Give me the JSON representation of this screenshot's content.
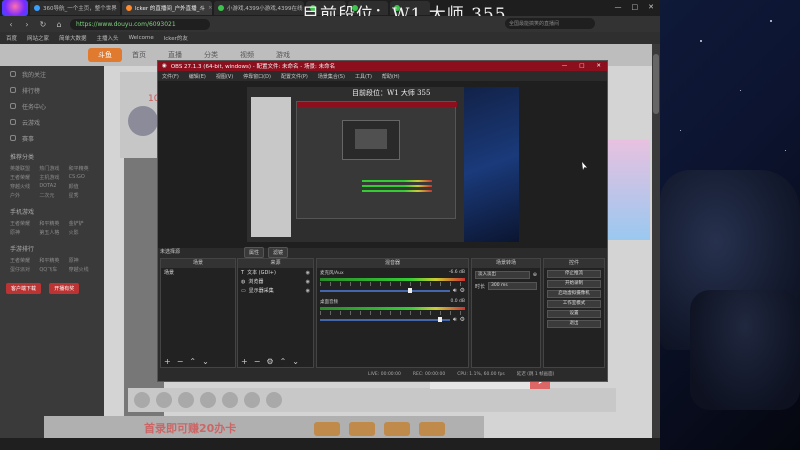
{
  "overlay_title": "目前段位：W1 大师 355",
  "browser": {
    "tabs": [
      {
        "label": "360导航_一个主页，整个世界",
        "color": "#3aa0ff"
      },
      {
        "label": "lcker 的直播间_户外直播_斗",
        "color": "#ff8a2b",
        "active": true
      },
      {
        "label": "小游戏,4399小游戏,4399在线",
        "color": "#3ec24e"
      },
      {
        "label": "",
        "color": "#3ec24e"
      },
      {
        "label": "",
        "color": "#3ec24e"
      },
      {
        "label": "",
        "color": "#3ec24e"
      }
    ],
    "url": "https://www.douyu.com/6093021",
    "bookmarks": [
      "百度",
      "网站之家",
      "简单大数据",
      "主播入头",
      "Welcome",
      "lcker的友"
    ],
    "search_placeholder": "全国最能搞笑的直播间"
  },
  "site": {
    "logo": "斗鱼",
    "nav": [
      "首页",
      "直播",
      "分类",
      "视频",
      "游戏"
    ],
    "sidebar": {
      "items": [
        "我的关注",
        "排行榜",
        "任务中心",
        "云游戏",
        "赛事"
      ],
      "sections": [
        {
          "title": "推荐分类",
          "tags": [
            "英雄联盟",
            "热门游戏",
            "和平精英",
            "王者荣耀",
            "主机游戏",
            "CS:GO",
            "穿越火线",
            "DOTA2",
            "颜值",
            "户外",
            "二次元",
            "星秀"
          ]
        },
        {
          "title": "手机游戏",
          "tags": [
            "王者荣耀",
            "和平精英",
            "金铲铲",
            "原神",
            "第五人格",
            "火影"
          ]
        },
        {
          "title": "手游排行",
          "tags": [
            "王者荣耀",
            "和平精英",
            "原神",
            "蛋仔派对",
            "QQ飞车",
            "穿越火线"
          ]
        }
      ],
      "buttons": [
        "客户端下载",
        "开播有奖"
      ]
    },
    "room_count": "10",
    "banner_text": "首录即可赚20办卡"
  },
  "obs": {
    "title": "OBS 27.1.3 (64-bit, windows) - 配置文件: 未命名 - 场景: 未命名",
    "menu": [
      "文件(F)",
      "编辑(E)",
      "视图(V)",
      "停靠窗口(D)",
      "配置文件(P)",
      "场景集合(S)",
      "工具(T)",
      "帮助(H)"
    ],
    "scene_label": "未选择源",
    "toolbar": [
      "属性",
      "滤镜"
    ],
    "docks": {
      "scenes": {
        "title": "场景",
        "items": [
          "场景"
        ]
      },
      "sources": {
        "title": "来源",
        "items": [
          "文本 (GDI+)",
          "浏览器",
          "显示器采集"
        ]
      },
      "mixer": {
        "title": "混音器",
        "tracks": [
          {
            "name": "麦克风/Aux",
            "db": "-6.6 dB"
          },
          {
            "name": "桌面音频",
            "db": "0.0 dB"
          }
        ]
      },
      "transitions": {
        "title": "场景转场",
        "type": "淡入淡出",
        "duration_label": "时长",
        "duration": "300 ms"
      },
      "controls": {
        "title": "控件",
        "buttons": [
          "停止推流",
          "开始录制",
          "启动虚拟摄像机",
          "工作室模式",
          "设置",
          "退出"
        ]
      }
    },
    "status": [
      "LIVE: 00:00:00",
      "REC: 00:00:00",
      "CPU: 1.1%, 60.00 fps",
      "延迟 (跳 1 帧画面)"
    ]
  },
  "heart_count": "0",
  "colors": {
    "obs_title": "#8b0f1d",
    "heart": "#e8343f",
    "url_green": "#7fd47f"
  }
}
